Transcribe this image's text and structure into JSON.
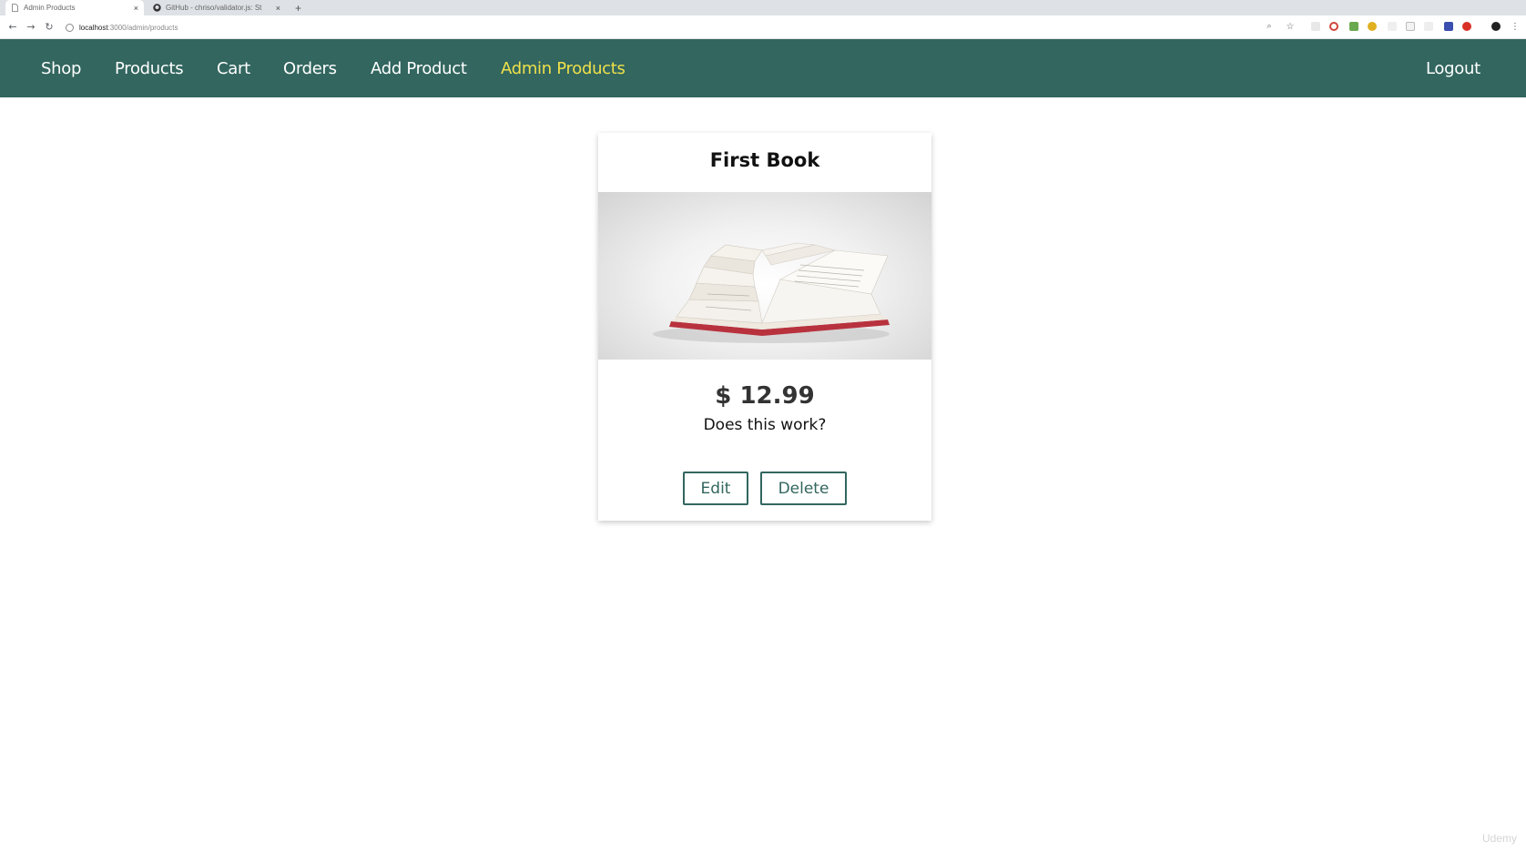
{
  "browser": {
    "tabs": [
      {
        "title": "Admin Products",
        "active": true
      },
      {
        "title": "GitHub - chriso/validator.js: St",
        "active": false
      }
    ],
    "url_host": "localhost",
    "url_path": ":3000/admin/products",
    "new_tab": "+",
    "close": "×"
  },
  "nav": {
    "links": [
      "Shop",
      "Products",
      "Cart",
      "Orders",
      "Add Product",
      "Admin Products"
    ],
    "active_link": "Admin Products",
    "logout": "Logout"
  },
  "product": {
    "title": "First Book",
    "price": "$ 12.99",
    "description": "Does this work?",
    "edit_label": "Edit",
    "delete_label": "Delete"
  },
  "colors": {
    "header_bg": "#32665f",
    "active_link": "#f0e04a",
    "button_accent": "#32665f"
  },
  "watermark": "Udemy"
}
